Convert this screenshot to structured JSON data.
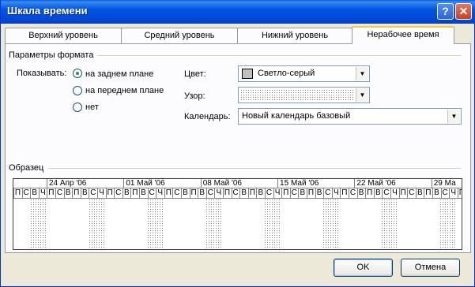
{
  "window": {
    "title": "Шкала времени",
    "help_btn": "?",
    "close_btn": "✕"
  },
  "tabs": [
    {
      "label": "Верхний уровень",
      "active": false
    },
    {
      "label": "Средний уровень",
      "active": false
    },
    {
      "label": "Нижний уровень",
      "active": false
    },
    {
      "label": "Нерабочее время",
      "active": true
    }
  ],
  "format": {
    "group_title": "Параметры формата",
    "show_label": "Показывать:",
    "show_options": [
      {
        "label": "на заднем плане",
        "selected": true
      },
      {
        "label": "на переднем плане",
        "selected": false
      },
      {
        "label": "нет",
        "selected": false
      }
    ],
    "color_label": "Цвет:",
    "color_value": "Светло-серый",
    "color_swatch": "#c0c0c0",
    "pattern_label": "Узор:",
    "pattern_value": "",
    "calendar_label": "Календарь:",
    "calendar_value": "Новый календарь базовый"
  },
  "sample": {
    "group_title": "Образец",
    "weeks": [
      "24 Апр '06",
      "01 Май '06",
      "08 Май '06",
      "15 Май '06",
      "22 Май '06",
      "29 Ма"
    ],
    "days": [
      "П",
      "С",
      "В",
      "Ч",
      "П",
      "С",
      "В",
      "П",
      "В",
      "С",
      "Ч",
      "П",
      "С",
      "В",
      "П",
      "В",
      "С",
      "Ч",
      "П",
      "С",
      "В",
      "П",
      "В",
      "С",
      "Ч",
      "П",
      "С",
      "В",
      "П",
      "В",
      "С",
      "Ч",
      "П",
      "С",
      "В",
      "П",
      "В",
      "С",
      "Ч",
      "П",
      "С",
      "В",
      "П",
      "В",
      "С",
      "Ч",
      "П",
      "С",
      "В",
      "П",
      "В",
      "С",
      "Ч",
      "П",
      "С",
      "В"
    ]
  },
  "buttons": {
    "ok": "OK",
    "cancel": "Отмена"
  }
}
